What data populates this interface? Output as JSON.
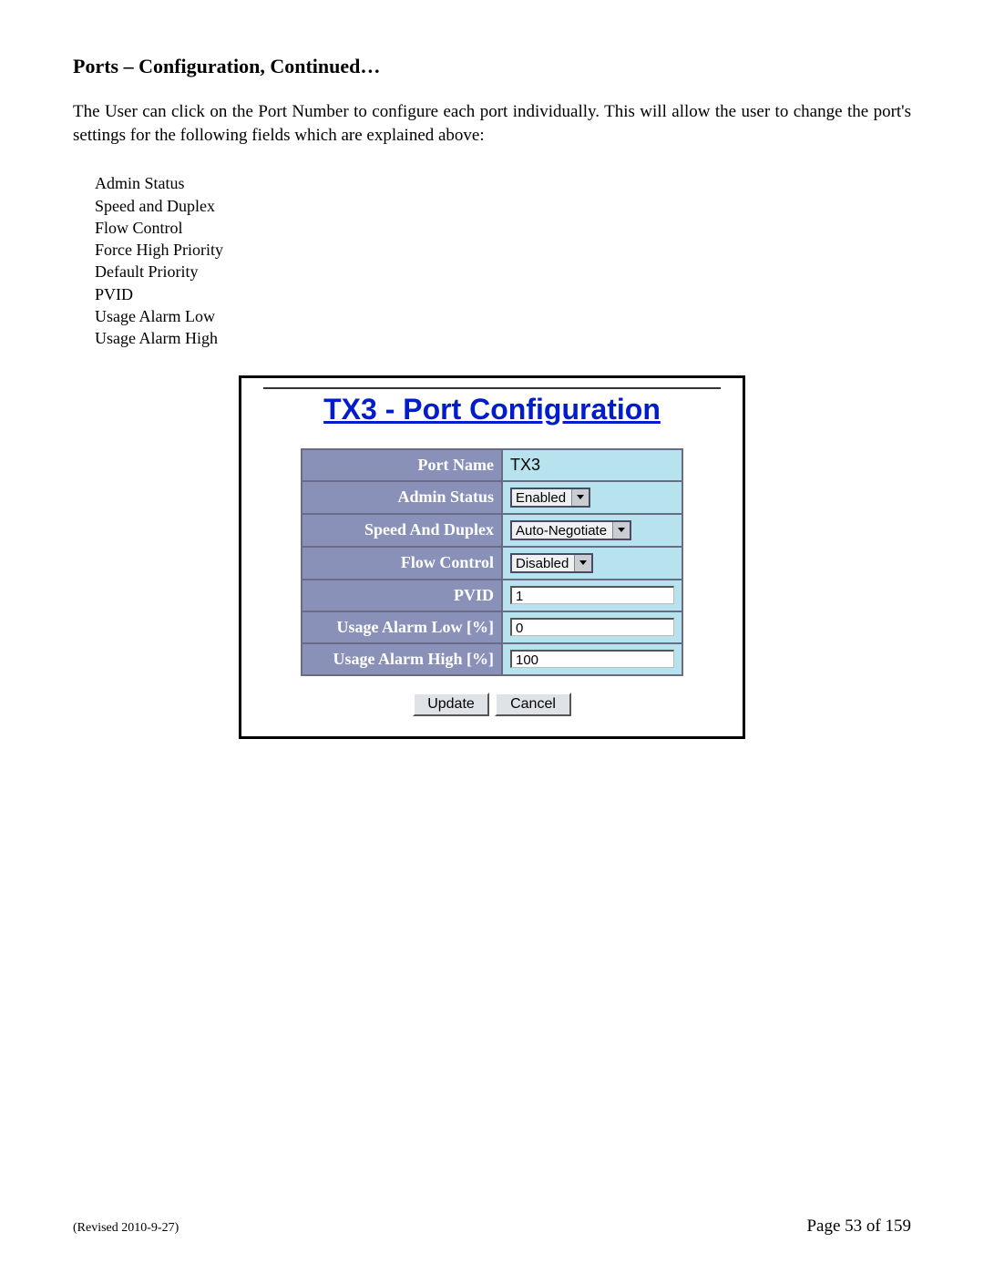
{
  "heading": "Ports – Configuration, Continued…",
  "paragraph": "The User can click on the Port Number to configure each port individually.  This will allow the user to change the port's settings for the following fields which are explained above:",
  "fields": [
    "Admin Status",
    "Speed and Duplex",
    "Flow Control",
    "Force High Priority",
    "Default Priority",
    "PVID",
    "Usage Alarm Low",
    "Usage Alarm High"
  ],
  "panel": {
    "title": "TX3 - Port Configuration",
    "rows": {
      "port_name": {
        "label": "Port Name",
        "value": "TX3"
      },
      "admin": {
        "label": "Admin Status",
        "value": "Enabled"
      },
      "speed": {
        "label": "Speed And Duplex",
        "value": "Auto-Negotiate"
      },
      "flow": {
        "label": "Flow Control",
        "value": "Disabled"
      },
      "pvid": {
        "label": "PVID",
        "value": "1"
      },
      "alarm_low": {
        "label": "Usage Alarm Low [%]",
        "value": "0"
      },
      "alarm_high": {
        "label": "Usage Alarm High [%]",
        "value": "100"
      }
    },
    "buttons": {
      "update": "Update",
      "cancel": "Cancel"
    }
  },
  "footer": {
    "revised": "(Revised 2010-9-27)",
    "page": "Page 53 of 159"
  }
}
